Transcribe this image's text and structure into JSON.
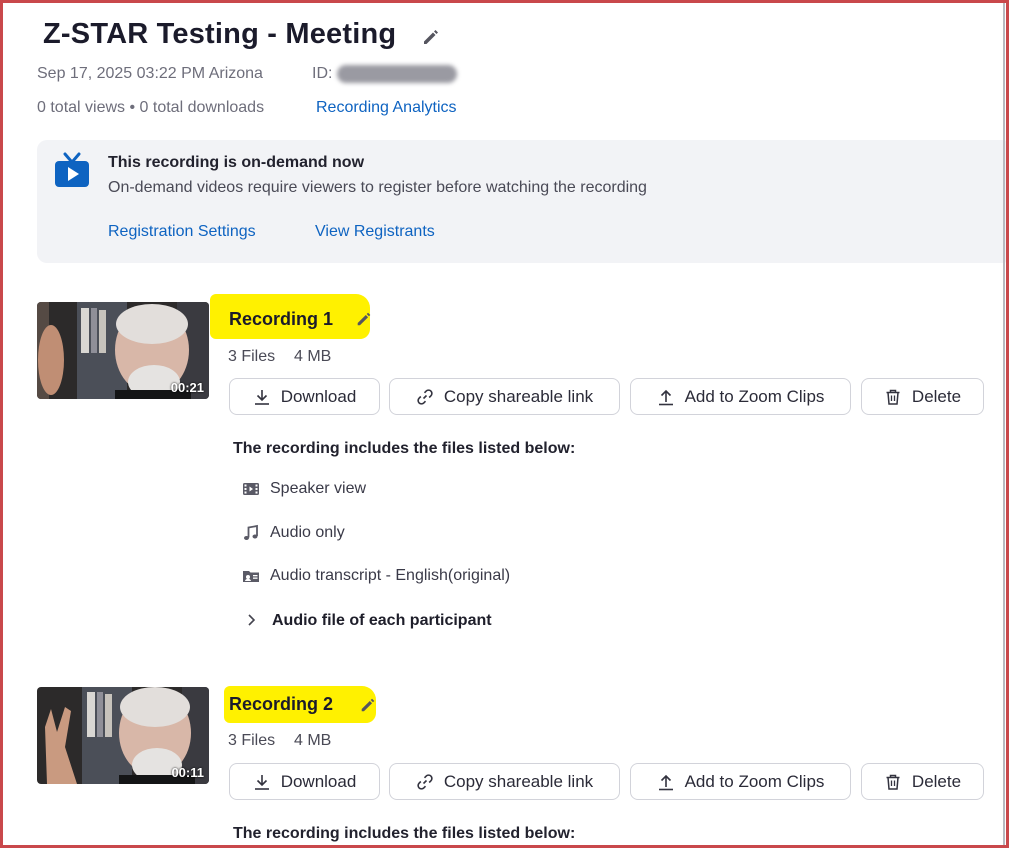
{
  "meeting": {
    "title": "Z-STAR Testing - Meeting",
    "date": "Sep 17, 2025 03:22 PM Arizona",
    "id_label": "ID:",
    "stats": "0 total views • 0 total downloads",
    "analytics_link": "Recording Analytics"
  },
  "banner": {
    "title": "This recording is on-demand now",
    "text": "On-demand videos require viewers to register before watching the recording",
    "link_settings": "Registration Settings",
    "link_registrants": "View Registrants",
    "icon": "tv-play-icon"
  },
  "recordings": [
    {
      "name": "Recording 1",
      "files_count": "3 Files",
      "size": "4 MB",
      "duration": "00:21",
      "actions": {
        "download": "Download",
        "copy": "Copy shareable link",
        "clips": "Add to Zoom Clips",
        "delete": "Delete"
      },
      "includes_label": "The recording includes the files listed below:",
      "files": [
        {
          "label": "Speaker view",
          "icon": "video-film-icon"
        },
        {
          "label": "Audio only",
          "icon": "music-note-icon"
        },
        {
          "label": "Audio transcript - English(original)",
          "icon": "transcript-icon"
        }
      ],
      "participants_label": "Audio file of each participant"
    },
    {
      "name": "Recording 2",
      "files_count": "3 Files",
      "size": "4 MB",
      "duration": "00:11",
      "actions": {
        "download": "Download",
        "copy": "Copy shareable link",
        "clips": "Add to Zoom Clips",
        "delete": "Delete"
      },
      "includes_label": "The recording includes the files listed below:"
    }
  ],
  "colors": {
    "link": "#0e63c1",
    "highlight": "#fff100",
    "frame": "#c9484b",
    "banner_bg": "#f2f3f6"
  }
}
